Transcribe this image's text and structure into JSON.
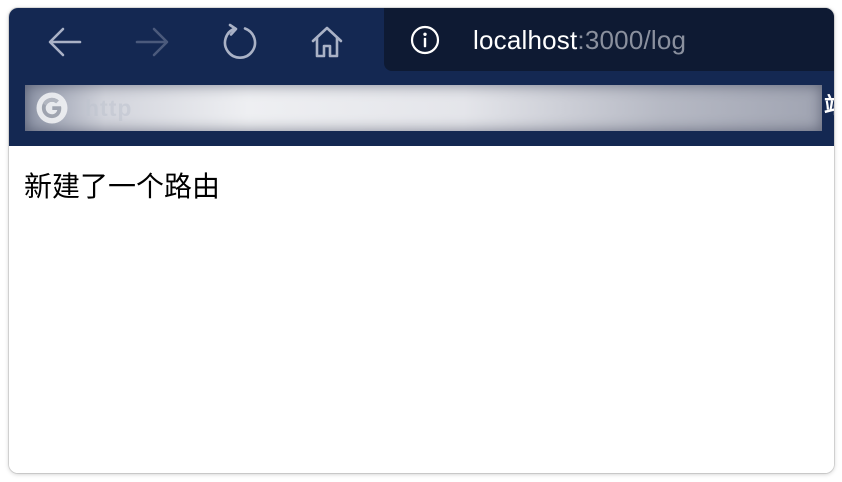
{
  "toolbar": {
    "background": "#142852",
    "back_icon": "arrow-left-icon",
    "forward_icon": "arrow-right-icon",
    "reload_icon": "reload-icon",
    "home_icon": "home-icon"
  },
  "address_bar": {
    "info_icon": "info-icon",
    "host": "localhost",
    "rest": ":3000/log",
    "background": "#0e1a33"
  },
  "search_bar": {
    "icon": "google-icon",
    "text": "http",
    "overflow_glyph": "站"
  },
  "page": {
    "text": "新建了一个路由"
  }
}
